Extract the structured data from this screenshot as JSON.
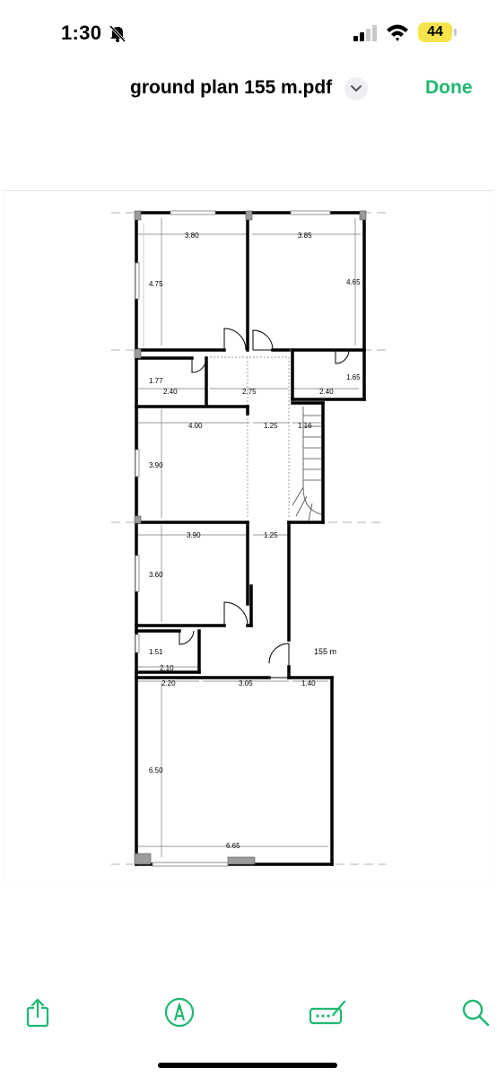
{
  "status_bar": {
    "time": "1:30",
    "battery_level": "44",
    "icons": [
      "bell-slash-icon",
      "cellular-signal-icon",
      "wifi-icon",
      "battery-icon"
    ]
  },
  "nav": {
    "title": "ground plan 155 m.pdf",
    "done_label": "Done",
    "accent_color": "#1fb870"
  },
  "floor_plan": {
    "dimensions": {
      "top_left_width": "3.80",
      "top_right_width": "3.85",
      "top_left_height": "4.75",
      "top_right_height": "4.65",
      "hall_left_height": "1.77",
      "hall_left_width": "2.40",
      "hall_mid_width": "2.75",
      "hall_right_width": "2.40",
      "hall_right_height": "1.65",
      "mid_room_width": "4.00",
      "corridor_width_1": "1.25",
      "stair_width": "1.16",
      "mid_room_height": "3.90",
      "lower_room_width": "3.90",
      "corridor_width_2": "1.25",
      "lower_room_height": "3.60",
      "small_room_height": "1.51",
      "small_room_width": "2.10",
      "bottom_seg_1": "2.20",
      "bottom_seg_2": "3.05",
      "bottom_seg_3": "1.40",
      "big_room_height": "6.50",
      "big_room_width": "6.65"
    },
    "area_label": "155 m"
  },
  "toolbar": {
    "items": [
      "share-icon",
      "markup-icon",
      "signature-icon",
      "search-icon"
    ]
  }
}
